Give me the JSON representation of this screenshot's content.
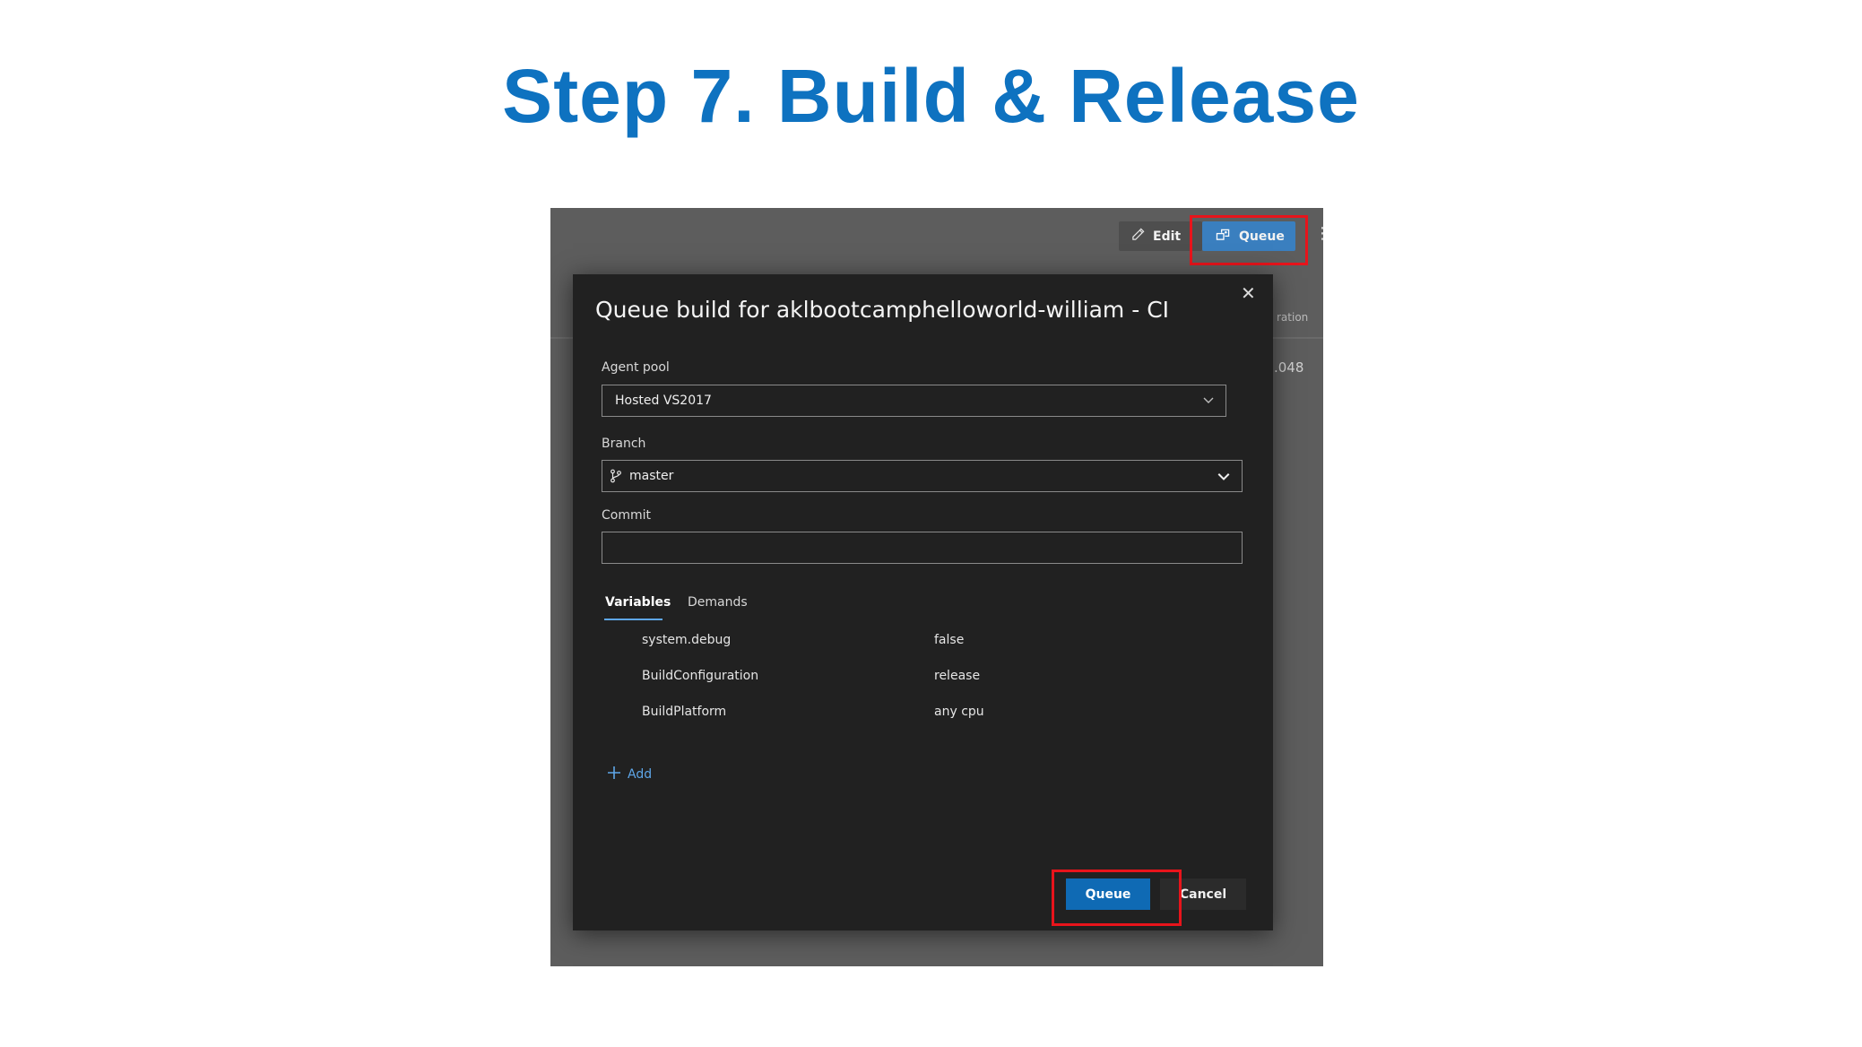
{
  "slide": {
    "title": "Step 7. Build & Release"
  },
  "background": {
    "column_header_partial": "ration",
    "cell_value_partial": ".048",
    "toolbar": {
      "edit_label": "Edit",
      "queue_label": "Queue",
      "edit_icon": "pencil-icon",
      "queue_icon": "queue-build-icon",
      "more_icon": "vertical-ellipsis-icon"
    }
  },
  "dialog": {
    "title": "Queue build for aklbootcamphelloworld-william - CI",
    "close_icon": "close-icon",
    "agent_pool": {
      "label": "Agent pool",
      "value": "Hosted VS2017"
    },
    "branch": {
      "label": "Branch",
      "value": "master",
      "icon": "git-branch-icon"
    },
    "commit": {
      "label": "Commit",
      "value": ""
    },
    "tabs": [
      {
        "label": "Variables",
        "active": true
      },
      {
        "label": "Demands",
        "active": false
      }
    ],
    "variables": [
      {
        "name": "system.debug",
        "value": "false"
      },
      {
        "name": "BuildConfiguration",
        "value": "release"
      },
      {
        "name": "BuildPlatform",
        "value": "any cpu"
      }
    ],
    "add_label": "Add",
    "queue_label": "Queue",
    "cancel_label": "Cancel"
  },
  "colors": {
    "title_blue": "#0e72c0",
    "highlight_red": "#e8141b",
    "primary_button": "#0f6ab4",
    "dialog_bg": "#212121",
    "link_blue": "#5ea6e8"
  }
}
